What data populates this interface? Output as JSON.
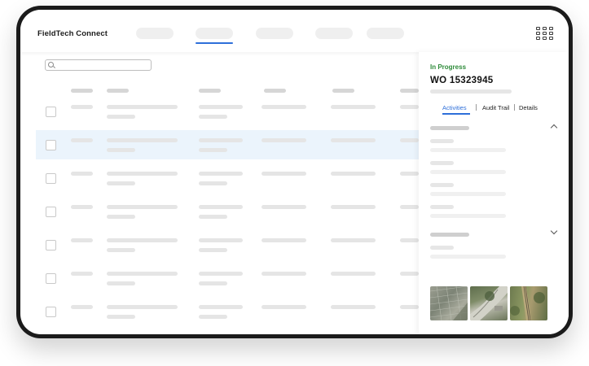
{
  "app": {
    "title": "FieldTech Connect"
  },
  "nav": {
    "items": [
      "",
      "",
      "",
      "",
      ""
    ],
    "active_index": 1
  },
  "search": {
    "placeholder": ""
  },
  "panel": {
    "status": "In Progress",
    "work_order": "WO 15323945",
    "tabs": [
      {
        "label": "Activities",
        "active": true
      },
      {
        "label": "Audit Trail",
        "active": false
      },
      {
        "label": "Details",
        "active": false
      }
    ],
    "sections": [
      {
        "expanded": true
      },
      {
        "expanded": false
      }
    ],
    "thumbnails": [
      "aerial-photo-1",
      "aerial-photo-2",
      "aerial-photo-3"
    ]
  },
  "colors": {
    "accent": "#2e6fd9",
    "status_green": "#2e8b3a",
    "row_highlight": "#ebf4fc",
    "frame": "#1b1b1b"
  }
}
